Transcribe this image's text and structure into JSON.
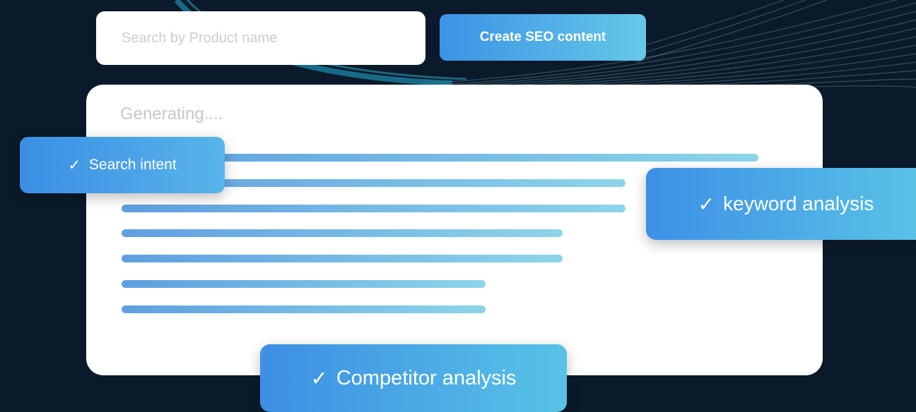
{
  "search": {
    "placeholder": "Search by Product name"
  },
  "toolbar": {
    "create_label": "Create SEO content"
  },
  "panel": {
    "status": "Generating....",
    "progress_lines": [
      0.91,
      0.72,
      0.72,
      0.63,
      0.63,
      0.52,
      0.52
    ]
  },
  "badges": {
    "search_intent": "Search intent",
    "keyword_analysis": "keyword analysis",
    "competitor_analysis": "Competitor analysis"
  },
  "icons": {
    "check": "✓"
  },
  "colors": {
    "background": "#0b1a2a",
    "accent_start": "#3b93e6",
    "accent_end": "#66c8e8"
  }
}
